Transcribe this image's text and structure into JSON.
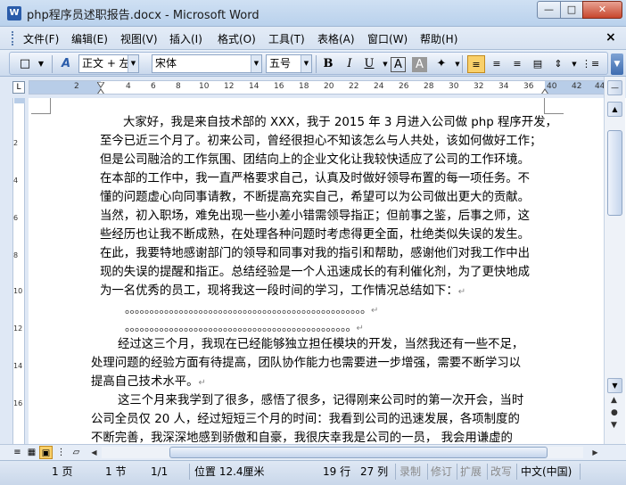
{
  "window": {
    "title": "php程序员述职报告.docx - Microsoft Word",
    "app_icon": "word-icon",
    "minimize": "—",
    "maximize": "□",
    "close": "✕"
  },
  "menu": {
    "items": [
      "文件(F)",
      "编辑(E)",
      "视图(V)",
      "插入(I)",
      "格式(O)",
      "工具(T)",
      "表格(A)",
      "窗口(W)",
      "帮助(H)"
    ],
    "doc_close": "×"
  },
  "toolbar": {
    "style_value": "正文 + 左侧",
    "font_value": "宋体",
    "size_value": "五号",
    "bold": "B",
    "italic": "I",
    "underline": "U",
    "char_border": "A",
    "char_shading": "A",
    "new_doc_icon": "new-document-icon",
    "styles_icon": "styles-icon",
    "highlight_icon": "format-painter-icon"
  },
  "ruler": {
    "tab_selector": "L",
    "numbers": [
      "2",
      "2",
      "4",
      "6",
      "8",
      "10",
      "12",
      "14",
      "16",
      "18",
      "20",
      "22",
      "24",
      "26",
      "28",
      "30",
      "32",
      "34",
      "36",
      "38",
      "40",
      "42",
      "44"
    ]
  },
  "vruler": {
    "numbers": [
      "2",
      "4",
      "6",
      "8",
      "10",
      "12",
      "14",
      "16"
    ]
  },
  "document": {
    "paragraph1": [
      "大家好，我是来自技术部的 XXX，我于 2015 年 3 月进入公司做 php 程序开发，",
      "至今已近三个月了。初来公司，曾经很担心不知该怎么与人共处，该如何做好工作；",
      "但是公司融洽的工作氛围、团结向上的企业文化让我较快适应了公司的工作环境。",
      "在本部的工作中，我一直严格要求自己，认真及时做好领导布置的每一项任务。不",
      "懂的问题虚心向同事请教，不断提高充实自己，希望可以为公司做出更大的贡献。",
      "当然，初入职场，难免出现一些小差小错需领导指正；但前事之鉴，后事之师，这",
      "些经历也让我不断成熟，在处理各种问题时考虑得更全面，杜绝类似失误的发生。",
      "在此，我要特地感谢部门的领导和同事对我的指引和帮助，感谢他们对我工作中出",
      "现的失误的提醒和指正。总结经验是一个人迅速成长的有利催化剂，为了更快地成",
      "为一名优秀的员工，现将我这一段时间的学习，工作情况总结如下："
    ],
    "dots1": "。。。。。。。。。。。。。。。。。。。。。。。。。。。。。。。。。。。。。。。。。。。。。。。。。",
    "dots2": "。。。。。。。。。。。。。。。。。。。。。。。。。。。。。。。。。。。。。。。。。。。。。。",
    "paragraph2": [
      "经过这三个月，我现在已经能够独立担任模块的开发，当然我还有一些不足，",
      "处理问题的经验方面有待提高，团队协作能力也需要进一步增强，需要不断学习以",
      "提高自己技术水平。"
    ],
    "paragraph3": [
      "这三个月来我学到了很多，感悟了很多，记得刚来公司时的第一次开会，当时",
      "公司全员仅 20 人，经过短短三个月的时间：我看到公司的迅速发展，各项制度的",
      "不断完善，我深深地感到骄傲和自豪，我很庆幸我是公司的一员， 我会用谦虚的"
    ],
    "return_mark": "↵"
  },
  "statusbar": {
    "page": "1 页",
    "section": "1 节",
    "page_of": "1/1",
    "position": "位置 12.4厘米",
    "line": "19 行",
    "column": "27 列",
    "rec": "录制",
    "trk": "修订",
    "ext": "扩展",
    "ovr": "改写",
    "language": "中文(中国)"
  }
}
